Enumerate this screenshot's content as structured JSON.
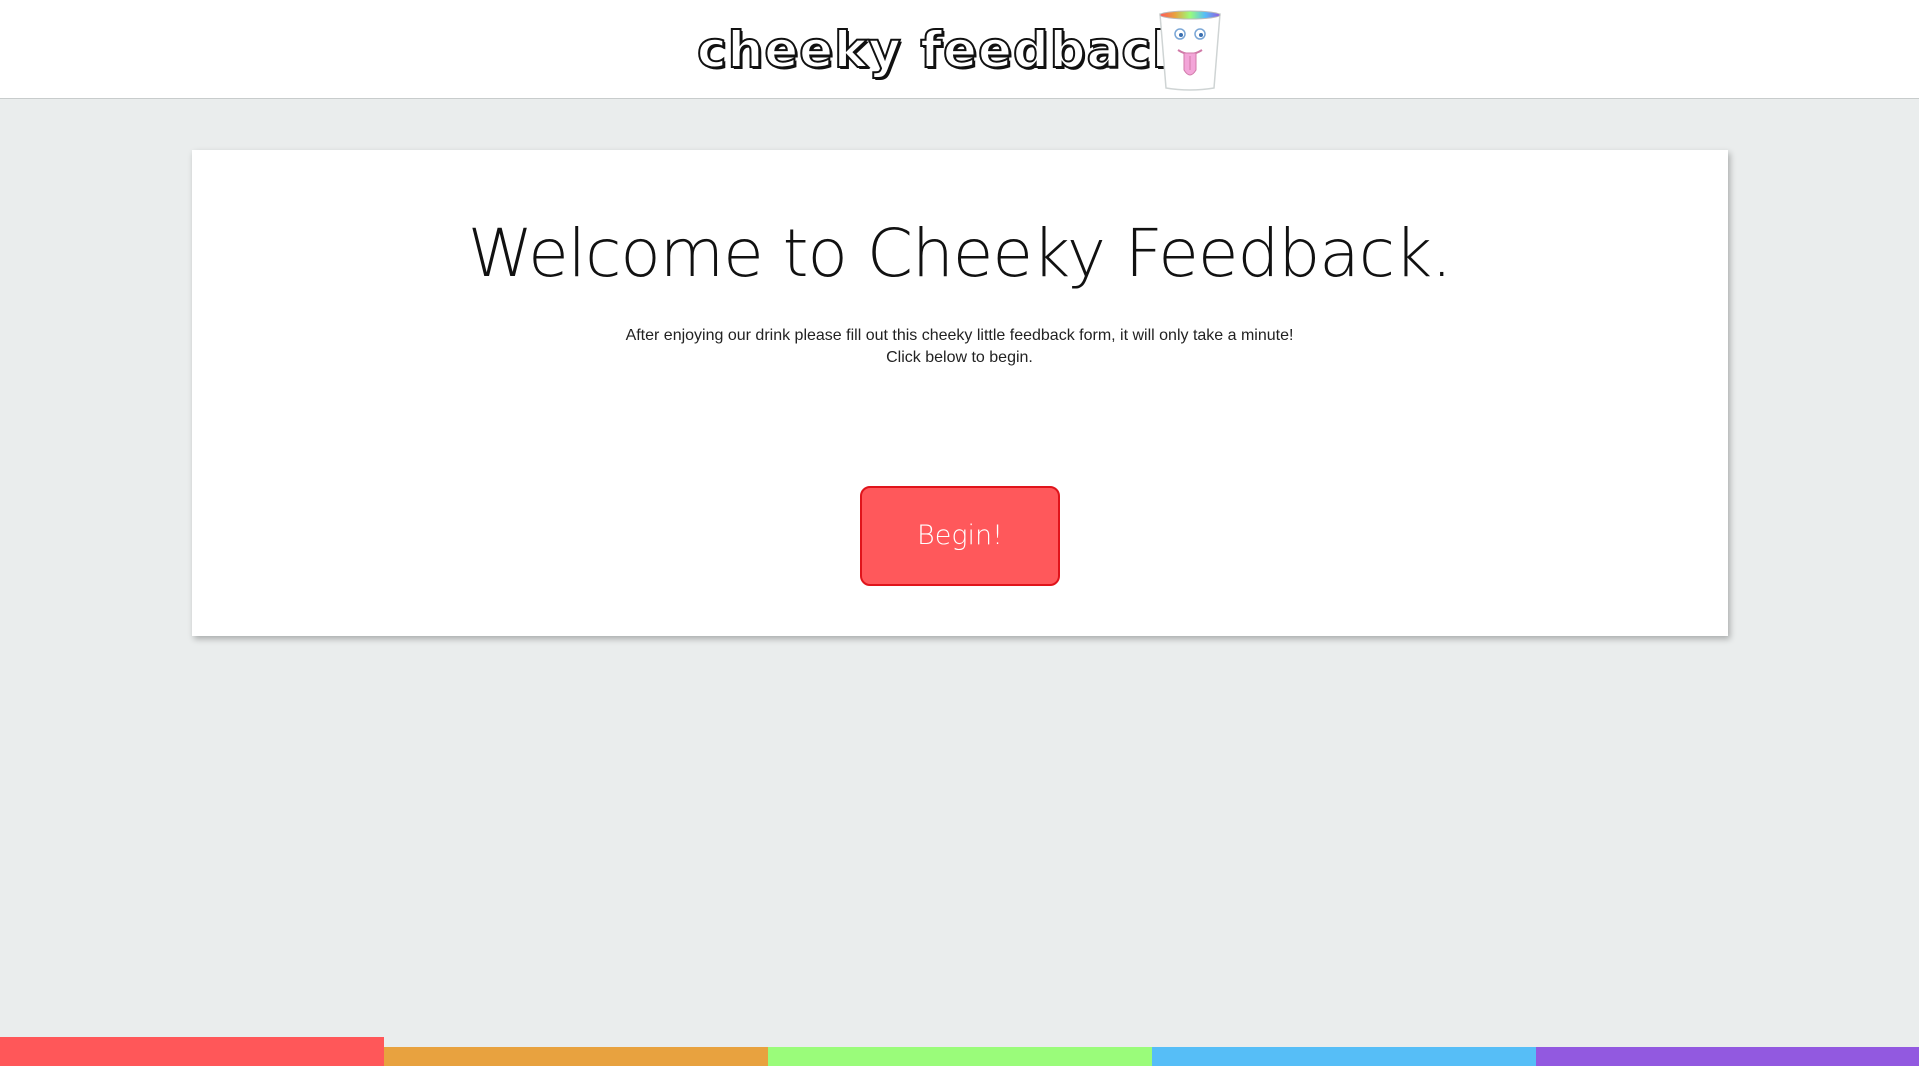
{
  "header": {
    "logo_text": "cheeky feedback",
    "logo_icon": "cup-face-icon"
  },
  "main": {
    "title": "Welcome to Cheeky Feedback.",
    "intro_line_1": "After enjoying our drink please fill out this cheeky little feedback form, it will only take a minute!",
    "intro_line_2": "Click below to begin.",
    "begin_label": "Begin!"
  },
  "colors": {
    "page_background": "#eaeded",
    "button": "#ff585b",
    "button_border": "#e0141b",
    "rainbow": [
      "#ff5759",
      "#e8a23f",
      "#9afc7a",
      "#56bef7",
      "#9259e0"
    ]
  }
}
